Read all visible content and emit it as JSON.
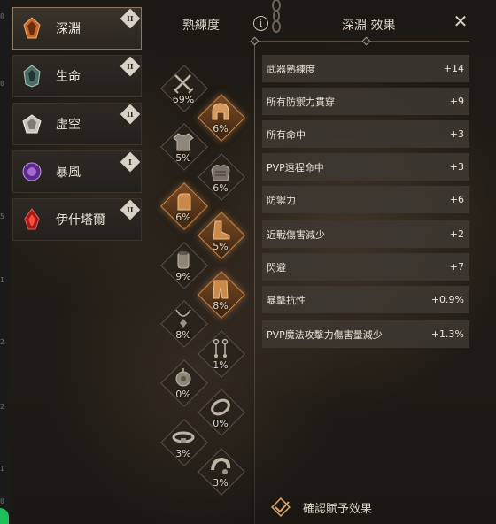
{
  "left_axis_ticks": [
    "0",
    "0",
    "5",
    "1",
    "2",
    "2",
    "1",
    "0"
  ],
  "elements": [
    {
      "label": "深淵",
      "badge": "II",
      "gem": "abyss",
      "active": true
    },
    {
      "label": "生命",
      "badge": "II",
      "gem": "life",
      "active": false
    },
    {
      "label": "虛空",
      "badge": "II",
      "gem": "void",
      "active": false
    },
    {
      "label": "暴風",
      "badge": "I",
      "gem": "storm",
      "active": false
    },
    {
      "label": "伊什塔爾",
      "badge": "II",
      "gem": "ishtar",
      "active": false
    }
  ],
  "header": {
    "proficiency_title": "熟練度",
    "info_icon": "i",
    "stats_title": "深淵 效果",
    "close_icon": "✕"
  },
  "equipment": [
    {
      "name": "weapon",
      "icon": "crossed-swords-icon",
      "value": "69%",
      "active": false
    },
    {
      "name": "helmet",
      "icon": "helmet-icon",
      "value": "6%",
      "active": true
    },
    {
      "name": "armor",
      "icon": "tunic-icon",
      "value": "5%",
      "active": false
    },
    {
      "name": "shoulder",
      "icon": "pauldron-icon",
      "value": "6%",
      "active": false
    },
    {
      "name": "gloves",
      "icon": "gauntlet-icon",
      "value": "6%",
      "active": true
    },
    {
      "name": "boots",
      "icon": "boot-icon",
      "value": "5%",
      "active": true
    },
    {
      "name": "bracer",
      "icon": "bracer-icon",
      "value": "9%",
      "active": false
    },
    {
      "name": "leggings",
      "icon": "leggings-icon",
      "value": "8%",
      "active": true
    },
    {
      "name": "necklace",
      "icon": "necklace-icon",
      "value": "8%",
      "active": false
    },
    {
      "name": "earrings",
      "icon": "earrings-icon",
      "value": "1%",
      "active": false
    },
    {
      "name": "amulet",
      "icon": "amulet-icon",
      "value": "0%",
      "active": false
    },
    {
      "name": "ring",
      "icon": "ring-icon",
      "value": "0%",
      "active": false
    },
    {
      "name": "belt",
      "icon": "belt-icon",
      "value": "3%",
      "active": false
    },
    {
      "name": "bangle",
      "icon": "bangle-icon",
      "value": "3%",
      "active": false
    }
  ],
  "stats": [
    {
      "name": "武器熟練度",
      "value": "+14"
    },
    {
      "name": "所有防禦力貫穿",
      "value": "+9"
    },
    {
      "name": "所有命中",
      "value": "+3"
    },
    {
      "name": "PVP遠程命中",
      "value": "+3"
    },
    {
      "name": "防禦力",
      "value": "+6"
    },
    {
      "name": "近戰傷害減少",
      "value": "+2"
    },
    {
      "name": "閃避",
      "value": "+7"
    },
    {
      "name": "暴擊抗性",
      "value": "+0.9%"
    },
    {
      "name": "PVP魔法攻擊力傷害量減少",
      "value": "+1.3%"
    }
  ],
  "confirm_label": "確認賦予效果",
  "colors": {
    "accent_active": "#c8874a",
    "stat_row_bg": "#3e3832",
    "text": "#ece6da"
  }
}
